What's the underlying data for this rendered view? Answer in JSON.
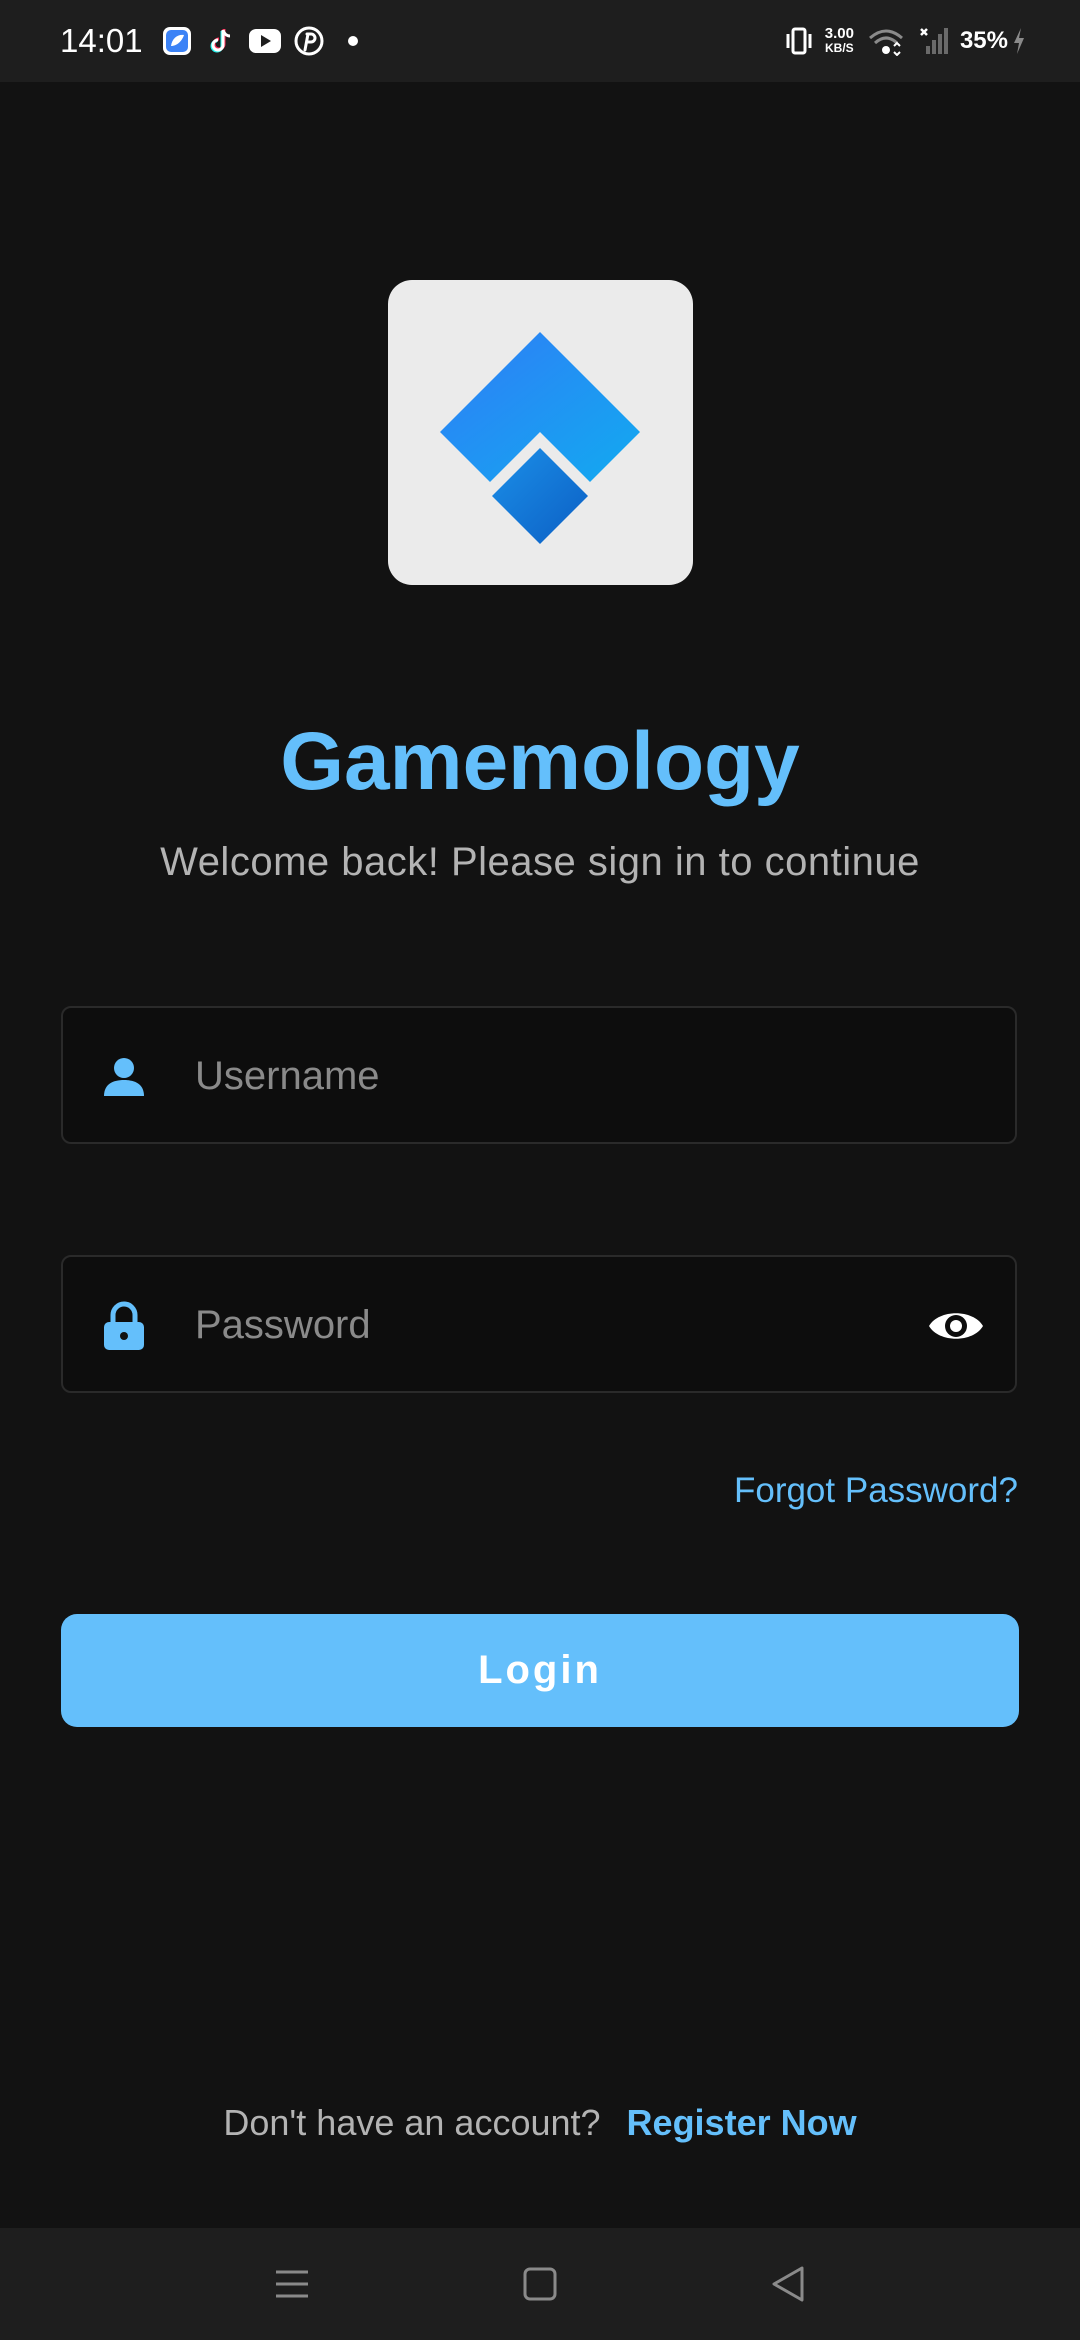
{
  "status_bar": {
    "time": "14:01",
    "net_speed_value": "3.00",
    "net_speed_unit": "KB/S",
    "battery": "35%",
    "left_icons": [
      "bluesky-icon",
      "tiktok-icon",
      "youtube-icon",
      "pinterest-icon",
      "dot-icon"
    ],
    "right_icons": [
      "vibrate-icon",
      "wifi-icon",
      "signal-icon",
      "charging-icon"
    ]
  },
  "app": {
    "title": "Gamemology",
    "subtitle": "Welcome back! Please sign in to continue"
  },
  "form": {
    "username_placeholder": "Username",
    "username_value": "",
    "password_placeholder": "Password",
    "password_value": "",
    "forgot_password": "Forgot Password?",
    "login_label": "Login"
  },
  "footer": {
    "register_prompt": "Don't have an account?",
    "register_link": "Register Now"
  },
  "nav_bar": {
    "buttons": [
      "menu-icon",
      "home-icon",
      "back-icon"
    ]
  },
  "colors": {
    "accent": "#64bffb",
    "background": "#121212",
    "field_background": "#0d0d0d",
    "muted_text": "#b3b3b3",
    "logo_tile": "#ebebeb"
  }
}
